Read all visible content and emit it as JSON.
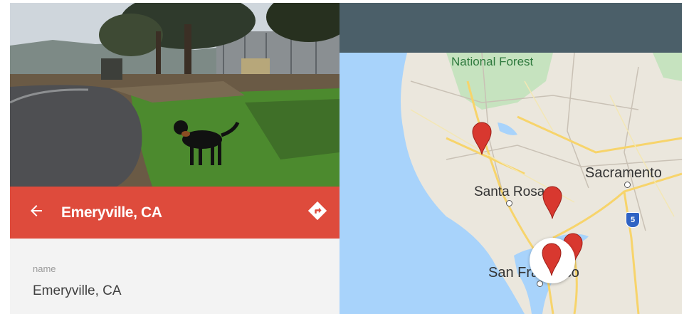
{
  "place": {
    "title": "Emeryville, CA",
    "field_label": "name",
    "field_value": "Emeryville, CA"
  },
  "map": {
    "labels": {
      "forest": "National Forest",
      "sacramento": "Sacramento",
      "santa_rosa": "Santa Rosa",
      "san_francisco": "San Francisco"
    },
    "highway": "5"
  },
  "colors": {
    "header_accent": "#de4b3c",
    "app_bar": "#4b5f69",
    "marker": "#d8382f",
    "water": "#a8d3fb"
  },
  "icons": {
    "back": "arrow-back-icon",
    "directions": "directions-icon",
    "marker": "map-marker-icon"
  }
}
